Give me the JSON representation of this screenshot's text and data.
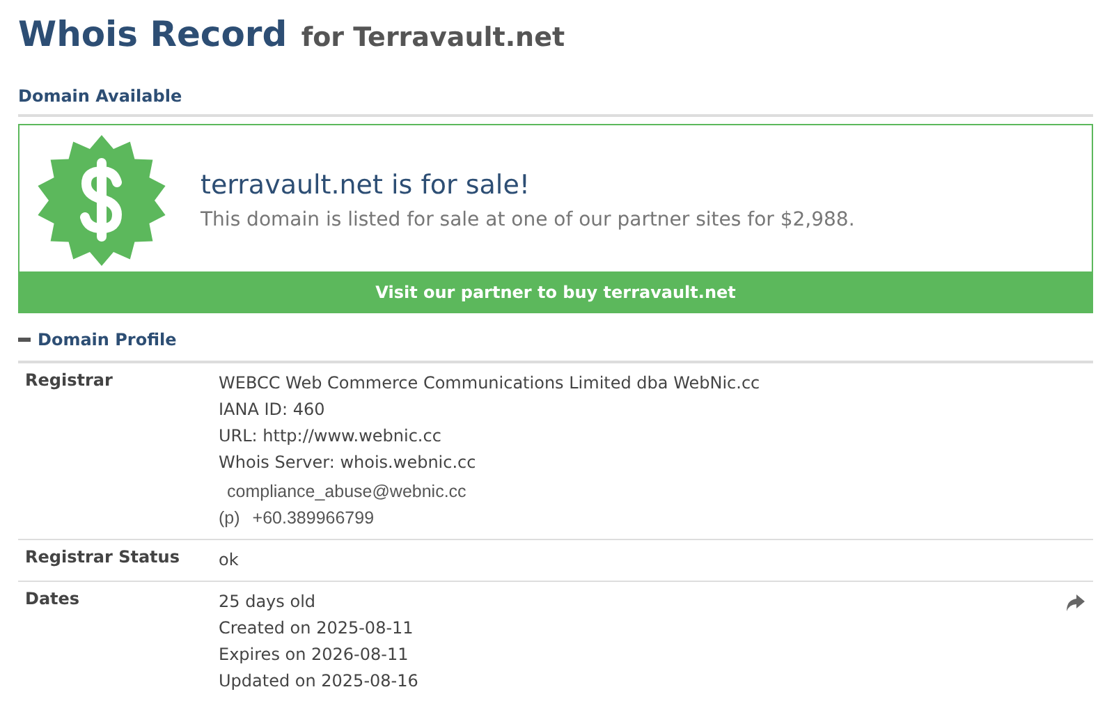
{
  "title": {
    "main": "Whois Record",
    "sub": "for Terravault.net"
  },
  "available": {
    "heading": "Domain Available",
    "headline": "terravault.net is for sale!",
    "text": "This domain is listed for sale at one of our partner sites for $2,988.",
    "button": "Visit our partner to buy terravault.net"
  },
  "profile": {
    "heading": "Domain Profile",
    "expanded": true,
    "rows": [
      {
        "label": "Registrar",
        "lines": [
          "WEBCC Web Commerce Communications Limited dba WebNic.cc",
          "IANA ID: 460",
          "URL: http://www.webnic.cc",
          "Whois Server: whois.webnic.cc"
        ],
        "contact": {
          "email": "compliance_abuse@webnic.cc",
          "phone_label": "(p)",
          "phone": "+60.389966799"
        },
        "share": false
      },
      {
        "label": "Registrar Status",
        "lines": [
          "ok"
        ],
        "share": false
      },
      {
        "label": "Dates",
        "lines": [
          "25 days old",
          "Created on 2025-08-11",
          "Expires on 2026-08-11",
          "Updated on 2025-08-16"
        ],
        "share": true
      }
    ]
  }
}
